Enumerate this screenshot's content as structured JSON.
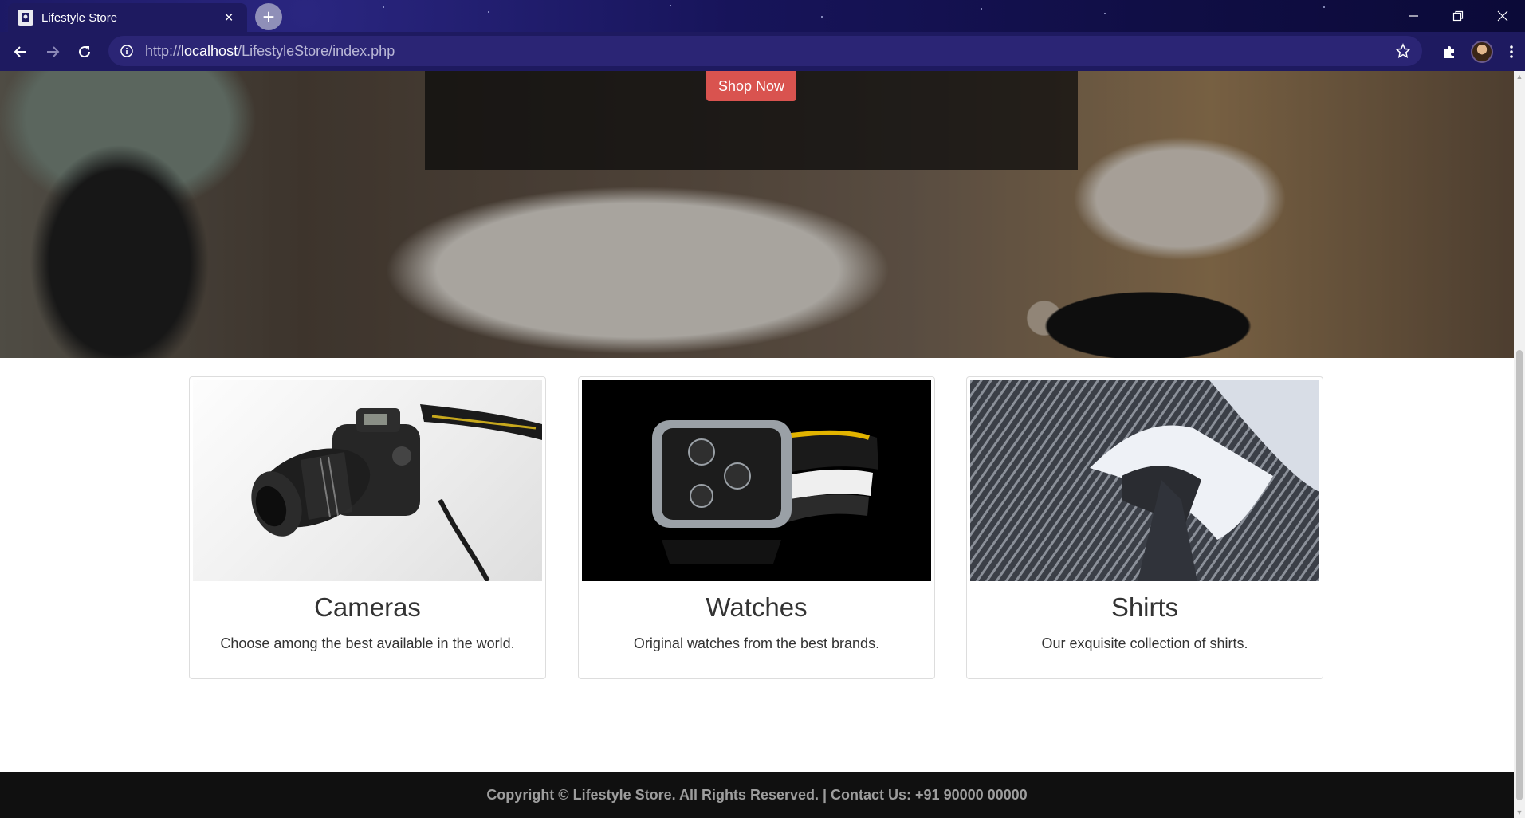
{
  "browser": {
    "tab_title": "Lifestyle Store",
    "url_prefix": "http://",
    "url_host": "localhost",
    "url_path": "/LifestyleStore/index.php"
  },
  "hero": {
    "cta_label": "Shop Now"
  },
  "categories": [
    {
      "title": "Cameras",
      "description": "Choose among the best available in the world.",
      "image_alt": "camera"
    },
    {
      "title": "Watches",
      "description": "Original watches from the best brands.",
      "image_alt": "watch"
    },
    {
      "title": "Shirts",
      "description": "Our exquisite collection of shirts.",
      "image_alt": "shirt"
    }
  ],
  "footer": {
    "text": "Copyright © Lifestyle Store. All Rights Reserved. | Contact Us: +91 90000 00000"
  },
  "colors": {
    "accent": "#d9534f",
    "chrome": "#1e1a60",
    "footer_bg": "#101010",
    "footer_text": "#9d9d9d"
  }
}
